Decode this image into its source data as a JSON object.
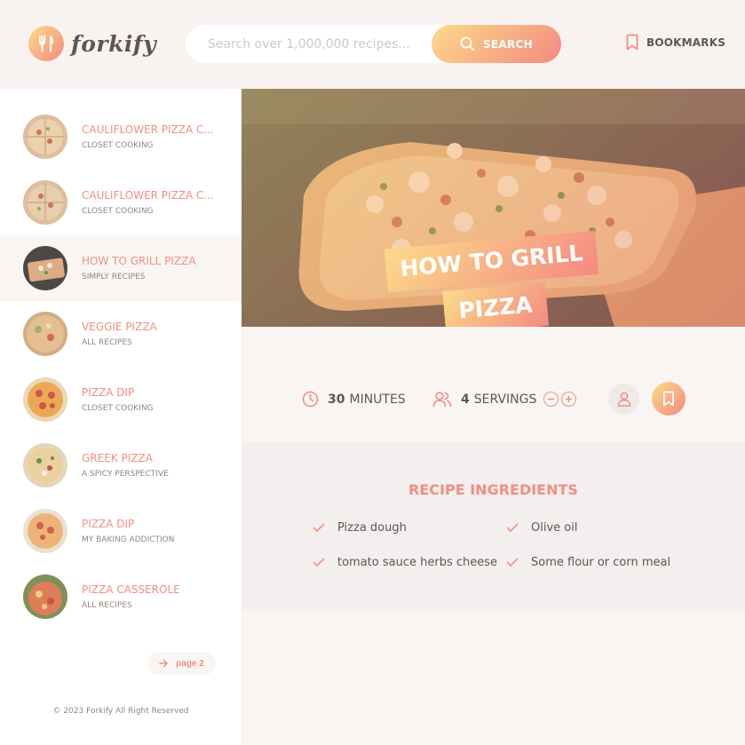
{
  "header": {
    "logo_text": "forkify",
    "search": {
      "placeholder": "Search over 1,000,000 recipes...",
      "value": "",
      "button_label": "SEARCH"
    },
    "bookmarks_label": "BOOKMARKS"
  },
  "sidebar": {
    "results": [
      {
        "title": "CAULIFLOWER PIZZA C...",
        "publisher": "CLOSET COOKING",
        "active": false
      },
      {
        "title": "CAULIFLOWER PIZZA C...",
        "publisher": "CLOSET COOKING",
        "active": false
      },
      {
        "title": "HOW TO GRILL PIZZA",
        "publisher": "SIMPLY RECIPES",
        "active": true
      },
      {
        "title": "VEGGIE PIZZA",
        "publisher": "ALL RECIPES",
        "active": false
      },
      {
        "title": "PIZZA DIP",
        "publisher": "CLOSET COOKING",
        "active": false
      },
      {
        "title": "GREEK PIZZA",
        "publisher": "A SPICY PERSPECTIVE",
        "active": false
      },
      {
        "title": "PIZZA DIP",
        "publisher": "MY BAKING ADDICTION",
        "active": false
      },
      {
        "title": "PIZZA CASSEROLE",
        "publisher": "ALL RECIPES",
        "active": false
      }
    ],
    "page_button": "page 2",
    "copyright": "© 2023 Forkify All Right Reserved"
  },
  "recipe": {
    "title_line1": "HOW TO GRILL",
    "title_line2": "PIZZA",
    "minutes": "30",
    "minutes_label": "MINUTES",
    "servings": "4",
    "servings_label": "SERVINGS",
    "ingredients_heading": "RECIPE INGREDIENTS",
    "ingredients": [
      "Pizza dough",
      "Olive oil",
      "tomato sauce herbs cheese",
      "Some flour or corn meal"
    ]
  },
  "colors": {
    "accent": "#f38e82",
    "gradient_start": "#fbdb89",
    "gradient_end": "#f48982",
    "text": "#615551"
  },
  "icons": [
    "fork-knife-icon",
    "search-icon",
    "bookmark-icon",
    "clock-icon",
    "users-icon",
    "minus-circle-icon",
    "plus-circle-icon",
    "user-icon",
    "check-icon",
    "arrow-right-icon"
  ]
}
